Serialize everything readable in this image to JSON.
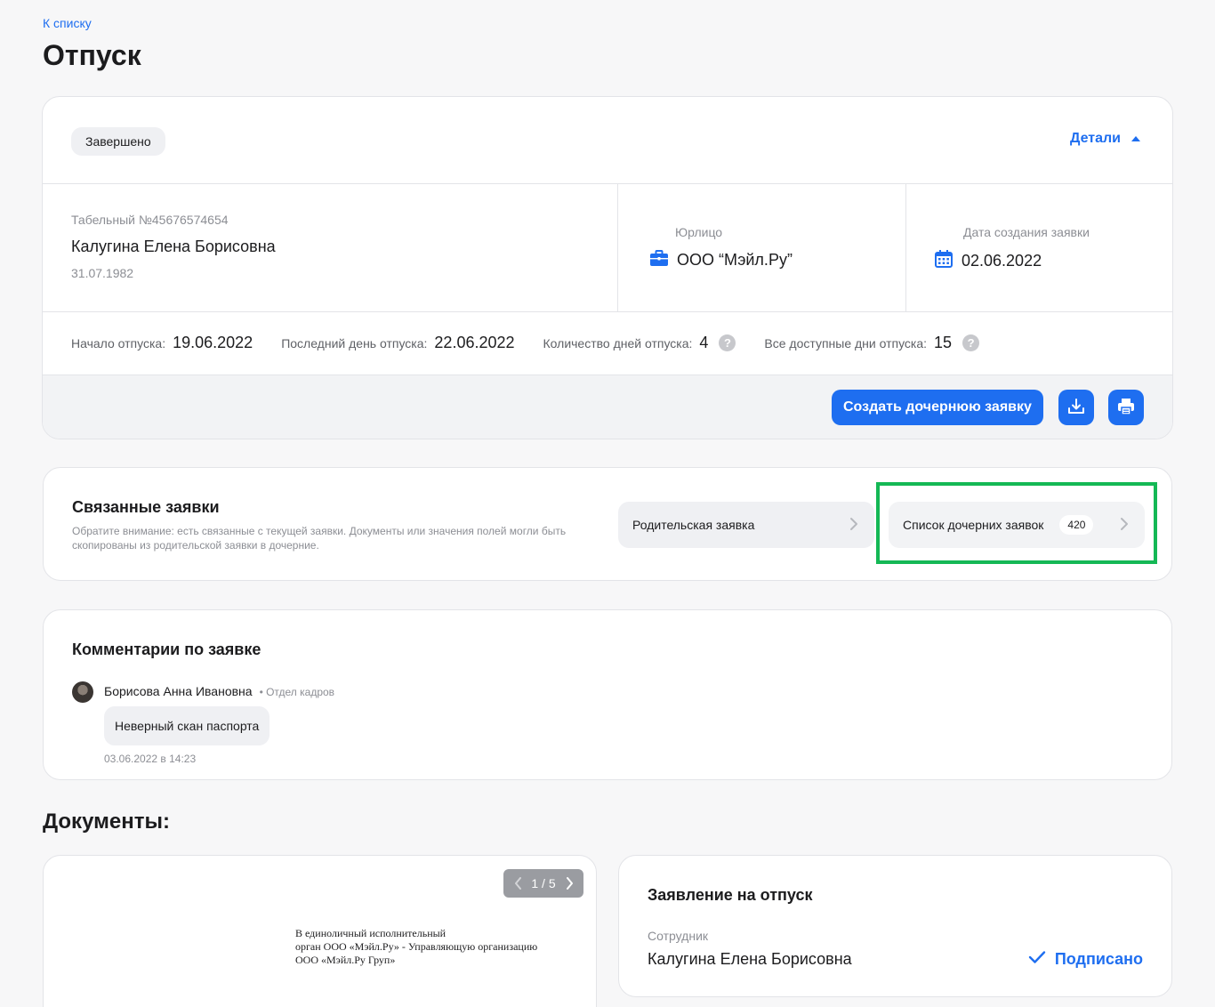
{
  "nav": {
    "back_label": "К списку"
  },
  "page": {
    "title": "Отпуск"
  },
  "request": {
    "status": "Завершено",
    "details_label": "Детали",
    "employee": {
      "number": "Табельный №45676574654",
      "name": "Калугина Елена Борисовна",
      "birth_date": "31.07.1982"
    },
    "legal_entity": {
      "label": "Юрлицо",
      "value": "ООО “Мэйл.Ру”"
    },
    "created": {
      "label": "Дата создания заявки",
      "value": "02.06.2022"
    },
    "stats": [
      {
        "label": "Начало отпуска:",
        "value": "19.06.2022",
        "help": false
      },
      {
        "label": "Последний день отпуска:",
        "value": "22.06.2022",
        "help": false
      },
      {
        "label": "Количество дней отпуска:",
        "value": "4",
        "help": true
      },
      {
        "label": "Все доступные дни отпуска:",
        "value": "15",
        "help": true
      }
    ],
    "actions": {
      "create_child_label": "Создать дочернюю заявку",
      "download_icon": "download-icon",
      "print_icon": "printer-icon"
    }
  },
  "related": {
    "title": "Связанные заявки",
    "note": "Обратите внимание: есть связанные с текущей заявки. Документы или значения полей могли быть скопированы из родительской заявки в дочерние.",
    "parent_label": "Родительская заявка",
    "children_label": "Список дочерних заявок",
    "children_count": "420",
    "highlight_color": "#14b855"
  },
  "comments": {
    "title": "Комментарии по заявке",
    "items": [
      {
        "author": "Борисова Анна Ивановна",
        "department": "• Отдел кадров",
        "text": "Неверный скан паспорта",
        "time": "03.06.2022 в 14:23"
      }
    ]
  },
  "documents": {
    "title": "Документы:",
    "preview": {
      "page_indicator": "1 / 5",
      "lines": [
        "В единоличный исполнительный",
        "орган ООО «Мэйл.Ру» - Управляющую организацию",
        "ООО «Мэйл.Ру Груп»"
      ]
    },
    "application": {
      "title": "Заявление на отпуск",
      "employee_label": "Сотрудник",
      "employee_name": "Калугина Елена Борисовна",
      "status": "Подписано"
    }
  },
  "colors": {
    "accent": "#1e6ef0",
    "background": "#f7f7f8",
    "border": "#e3e4e8"
  }
}
